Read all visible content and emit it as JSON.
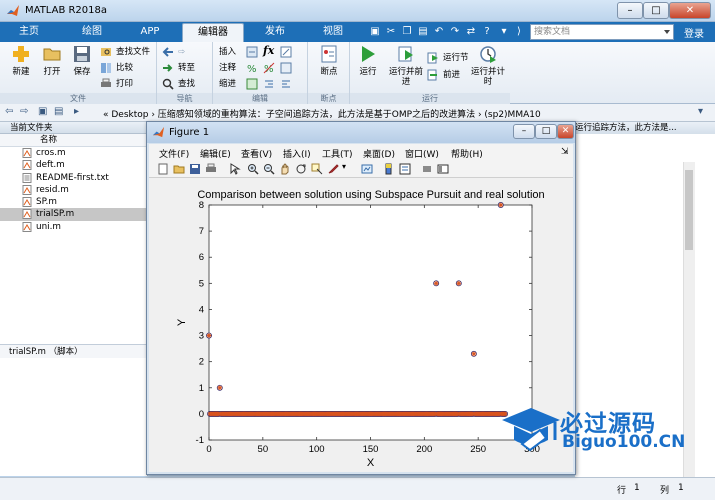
{
  "window": {
    "title": "MATLAB R2018a",
    "min": "–",
    "max": "□",
    "close": "✕"
  },
  "tabs": [
    {
      "label": "主页"
    },
    {
      "label": "绘图"
    },
    {
      "label": "APP"
    },
    {
      "label": "编辑器"
    },
    {
      "label": "发布"
    },
    {
      "label": "视图"
    }
  ],
  "search": {
    "placeholder": "搜索文档"
  },
  "login": "登录",
  "ribbon": {
    "file_group": {
      "label": "文件",
      "new": "新建",
      "open": "打开",
      "save": "保存",
      "find_files": "查找文件",
      "compare": "比较",
      "print": "打印"
    },
    "nav_group": {
      "label": "导航",
      "goto": "转至",
      "find": "查找"
    },
    "edit_group": {
      "label": "编辑",
      "insert": "插入",
      "comment": "注释",
      "indent": "缩进",
      "fx": "fx"
    },
    "break_group": {
      "label": "断点",
      "breakpoints": "断点"
    },
    "run_group": {
      "label": "运行",
      "run": "运行",
      "run_advance": "运行并前进",
      "run_section": "运行节",
      "advance": "前进",
      "run_time": "运行并计时"
    }
  },
  "address": {
    "path": "«  Desktop  ›  压缩感知领域的重构算法：子空间追踪方法，此方法是基于OMP之后的改进算法  ›  (sp2)MMA10"
  },
  "current_folder": {
    "title": "当前文件夹",
    "column": "名称",
    "files": [
      {
        "name": "cros.m"
      },
      {
        "name": "deft.m"
      },
      {
        "name": "README-first.txt"
      },
      {
        "name": "resid.m"
      },
      {
        "name": "SP.m"
      },
      {
        "name": "trialSP.m"
      },
      {
        "name": "uni.m"
      }
    ],
    "detail": "trialSP.m  （脚本）"
  },
  "right_panel": {
    "text": "运行追踪方法，此方法是..."
  },
  "status": {
    "row_label": "行",
    "row": "1",
    "col_label": "列",
    "col": "1"
  },
  "figure": {
    "title": "Figure 1",
    "min": "–",
    "max": "□",
    "close": "✕",
    "menu": [
      "文件(F)",
      "编辑(E)",
      "查看(V)",
      "插入(I)",
      "工具(T)",
      "桌面(D)",
      "窗口(W)",
      "帮助(H)"
    ]
  },
  "chart_data": {
    "type": "scatter",
    "title": "Comparison between solution using Subspace Pursuit and real solution",
    "xlabel": "X",
    "ylabel": "Y",
    "xlim": [
      0,
      300
    ],
    "ylim": [
      -1,
      8
    ],
    "xticks": [
      0,
      50,
      100,
      150,
      200,
      250,
      300
    ],
    "yticks": [
      -1,
      0,
      1,
      2,
      3,
      4,
      5,
      6,
      7,
      8
    ],
    "grid": false,
    "series": [
      {
        "marker": "o",
        "color": "#1f1f6f",
        "points": [
          [
            0,
            3
          ],
          [
            10,
            1
          ],
          [
            211,
            5
          ],
          [
            232,
            5
          ],
          [
            246,
            2.3
          ],
          [
            271,
            8
          ]
        ],
        "zero_range": [
          0,
          275
        ]
      },
      {
        "marker": "*",
        "color": "#d9531e",
        "points": [
          [
            0,
            3
          ],
          [
            10,
            1
          ],
          [
            211,
            5
          ],
          [
            232,
            5
          ],
          [
            246,
            2.3
          ],
          [
            271,
            8
          ]
        ],
        "zero_range": [
          0,
          275
        ]
      }
    ]
  },
  "watermark": {
    "cn": "必过源码",
    "en": "Biguo100.CN"
  }
}
